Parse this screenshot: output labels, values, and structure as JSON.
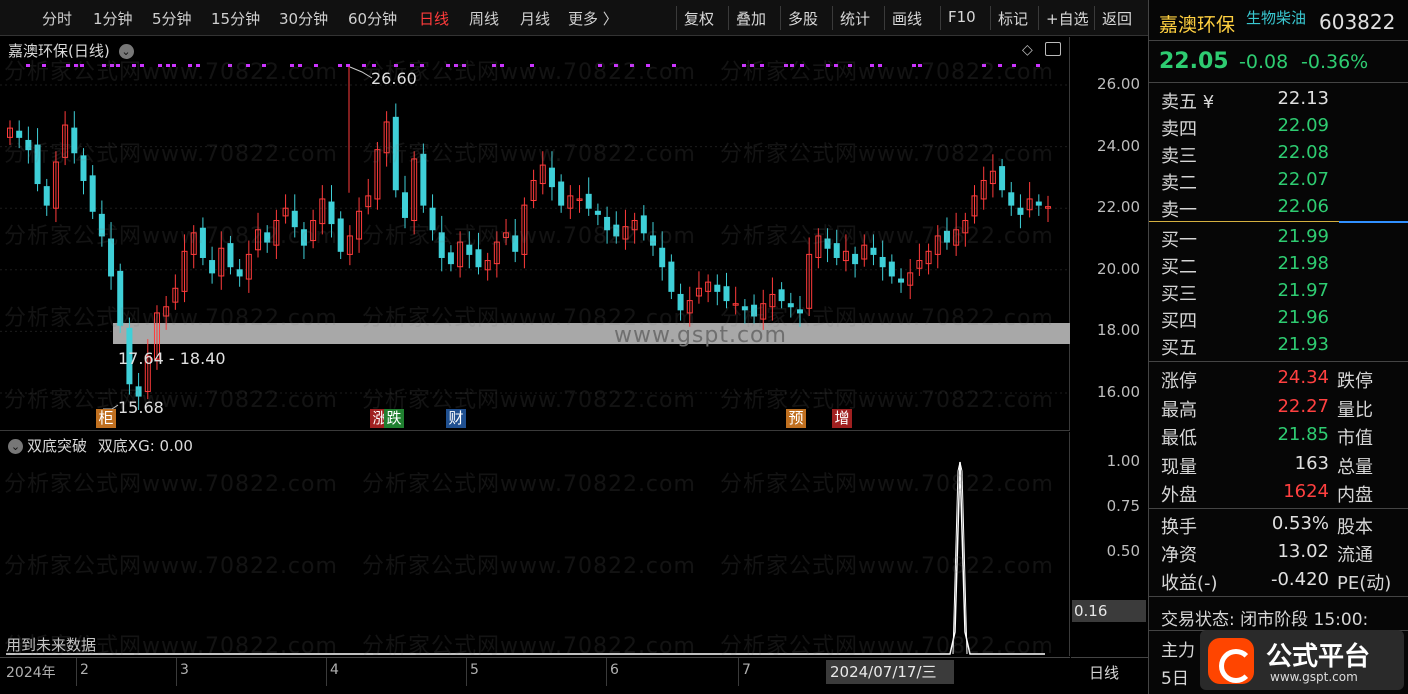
{
  "toolbar": {
    "periods": [
      "分时",
      "1分钟",
      "5分钟",
      "15分钟",
      "30分钟",
      "60分钟",
      "日线",
      "周线",
      "月线",
      "更多 〉"
    ],
    "active_period": "日线",
    "controls": [
      "复权",
      "叠加",
      "多股",
      "统计",
      "画线",
      "F10",
      "标记",
      "+自选",
      "返回"
    ]
  },
  "main_chart": {
    "title": "嘉澳环保(日线)",
    "y_ticks": [
      "26.00",
      "24.00",
      "22.00",
      "20.00",
      "18.00",
      "16.00"
    ],
    "annotations": {
      "high_label": "26.60",
      "low_label": "15.68",
      "range_label": "17.64 - 18.40",
      "band_watermark": "www.gspt.com"
    },
    "event_markers": [
      {
        "text": "柜",
        "color": "#c07020"
      },
      {
        "text": "涨",
        "color": "#a02020"
      },
      {
        "text": "跌",
        "color": "#208030"
      },
      {
        "text": "财",
        "color": "#205090"
      },
      {
        "text": "预",
        "color": "#c07020"
      },
      {
        "text": "增",
        "color": "#a02020"
      }
    ],
    "colors": {
      "up": "#ff3b3b",
      "down": "#3fd0d8",
      "band": "#a8a8a8",
      "dots": "#cc33ff"
    }
  },
  "sub_chart": {
    "title": "双底突破",
    "value_text": "双底XG: 0.00",
    "y_ticks": [
      "1.00",
      "0.75",
      "0.50"
    ],
    "cursor_value": "0.16",
    "footnote": "用到未来数据"
  },
  "xaxis": {
    "labels": [
      "2024年",
      "2",
      "3",
      "4",
      "5",
      "6",
      "7"
    ],
    "crosshair_date": "2024/07/17/三",
    "period_label": "日线"
  },
  "watermarks": [
    "分析家公式网www.70822.com"
  ],
  "quote": {
    "name": "嘉澳环保",
    "industry_tag": "生物柴油",
    "code": "603822",
    "price": "22.05",
    "change": "-0.08",
    "change_pct": "-0.36%",
    "asks": [
      {
        "label": "卖五 ¥",
        "price": "22.13",
        "color": "#e0e0e0"
      },
      {
        "label": "卖四",
        "price": "22.09"
      },
      {
        "label": "卖三",
        "price": "22.08"
      },
      {
        "label": "卖二",
        "price": "22.07"
      },
      {
        "label": "卖一",
        "price": "22.06"
      }
    ],
    "bids": [
      {
        "label": "买一",
        "price": "21.99"
      },
      {
        "label": "买二",
        "price": "21.98"
      },
      {
        "label": "买三",
        "price": "21.97"
      },
      {
        "label": "买四",
        "price": "21.96"
      },
      {
        "label": "买五",
        "price": "21.93"
      }
    ],
    "stats": [
      {
        "label": "涨停",
        "value": "24.34",
        "color": "red",
        "label2": "跌停"
      },
      {
        "label": "最高",
        "value": "22.27",
        "color": "red",
        "label2": "量比"
      },
      {
        "label": "最低",
        "value": "21.85",
        "color": "green",
        "label2": "市值"
      },
      {
        "label": "现量",
        "value": "163",
        "color": "",
        "label2": "总量"
      },
      {
        "label": "外盘",
        "value": "1624",
        "color": "red",
        "label2": "内盘"
      }
    ],
    "stats2": [
      {
        "label": "换手",
        "value": "0.53%",
        "label2": "股本"
      },
      {
        "label": "净资",
        "value": "13.02",
        "label2": "流通"
      },
      {
        "label": "收益(-)",
        "value": "-0.420",
        "label2": "PE(动)"
      }
    ],
    "trade_status": "交易状态: 闭市阶段 15:00:",
    "bottom_rows": [
      "主力",
      "5日"
    ]
  },
  "badge": {
    "title": "公式平台",
    "url": "www.gspt.com"
  }
}
